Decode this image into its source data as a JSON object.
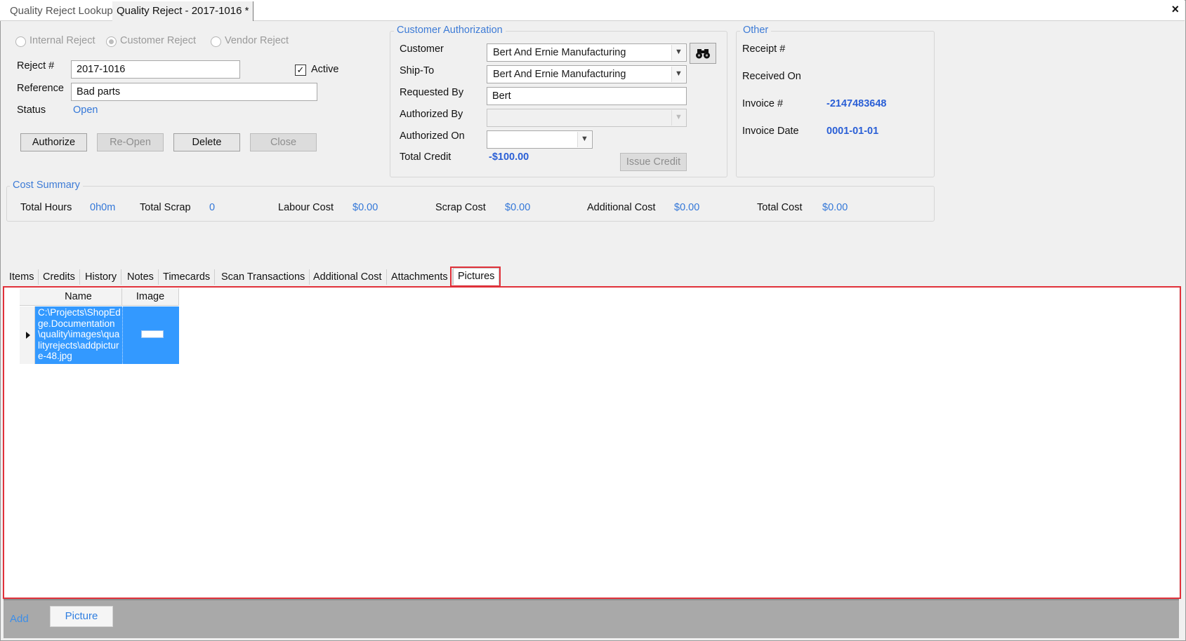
{
  "tabs": {
    "lookup": "Quality Reject Lookup",
    "current": "Quality Reject - 2017-1016 *",
    "close": "×"
  },
  "reject_type": {
    "internal": "Internal Reject",
    "customer": "Customer Reject",
    "vendor": "Vendor Reject",
    "selected": "Customer Reject"
  },
  "form": {
    "reject_label": "Reject #",
    "reject_value": "2017-1016",
    "active_label": "Active",
    "active_checked": "✓",
    "reference_label": "Reference",
    "reference_value": "Bad parts",
    "status_label": "Status",
    "status_value": "Open"
  },
  "buttons": {
    "authorize": "Authorize",
    "reopen": "Re-Open",
    "delete": "Delete",
    "close": "Close",
    "issue_credit": "Issue Credit"
  },
  "customer_auth": {
    "title": "Customer Authorization",
    "customer_label": "Customer",
    "customer_value": "Bert And Ernie Manufacturing",
    "shipto_label": "Ship-To",
    "shipto_value": "Bert And Ernie Manufacturing",
    "requested_by_label": "Requested By",
    "requested_by_value": "Bert",
    "authorized_by_label": "Authorized By",
    "authorized_by_value": "",
    "authorized_on_label": "Authorized On",
    "authorized_on_value": "",
    "total_credit_label": "Total Credit",
    "total_credit_value": "-$100.00"
  },
  "other": {
    "title": "Other",
    "receipt_label": "Receipt #",
    "received_on_label": "Received On",
    "invoice_label": "Invoice #",
    "invoice_value": "-2147483648",
    "invoice_date_label": "Invoice Date",
    "invoice_date_value": "0001-01-01"
  },
  "cost_summary": {
    "title": "Cost Summary",
    "total_hours_label": "Total Hours",
    "total_hours_value": "0h0m",
    "total_scrap_label": "Total Scrap",
    "total_scrap_value": "0",
    "labour_cost_label": "Labour Cost",
    "labour_cost_value": "$0.00",
    "scrap_cost_label": "Scrap Cost",
    "scrap_cost_value": "$0.00",
    "additional_cost_label": "Additional Cost",
    "additional_cost_value": "$0.00",
    "total_cost_label": "Total Cost",
    "total_cost_value": "$0.00"
  },
  "sub_tabs": [
    "Items",
    "Credits",
    "History",
    "Notes",
    "Timecards",
    "Scan Transactions",
    "Additional Cost",
    "Attachments",
    "Pictures"
  ],
  "active_sub_tab": "Pictures",
  "grid": {
    "columns": [
      "Name",
      "Image"
    ],
    "rows": [
      {
        "name": "C:\\Projects\\ShopEdge.Documentation\\quality\\images\\qualityrejects\\addpicture-48.jpg"
      }
    ]
  },
  "bottom": {
    "add_label": "Add",
    "picture_button": "Picture"
  },
  "colors": {
    "accent": "#3d7bd6",
    "selection": "#3399ff",
    "highlight_box": "#e0313a"
  }
}
